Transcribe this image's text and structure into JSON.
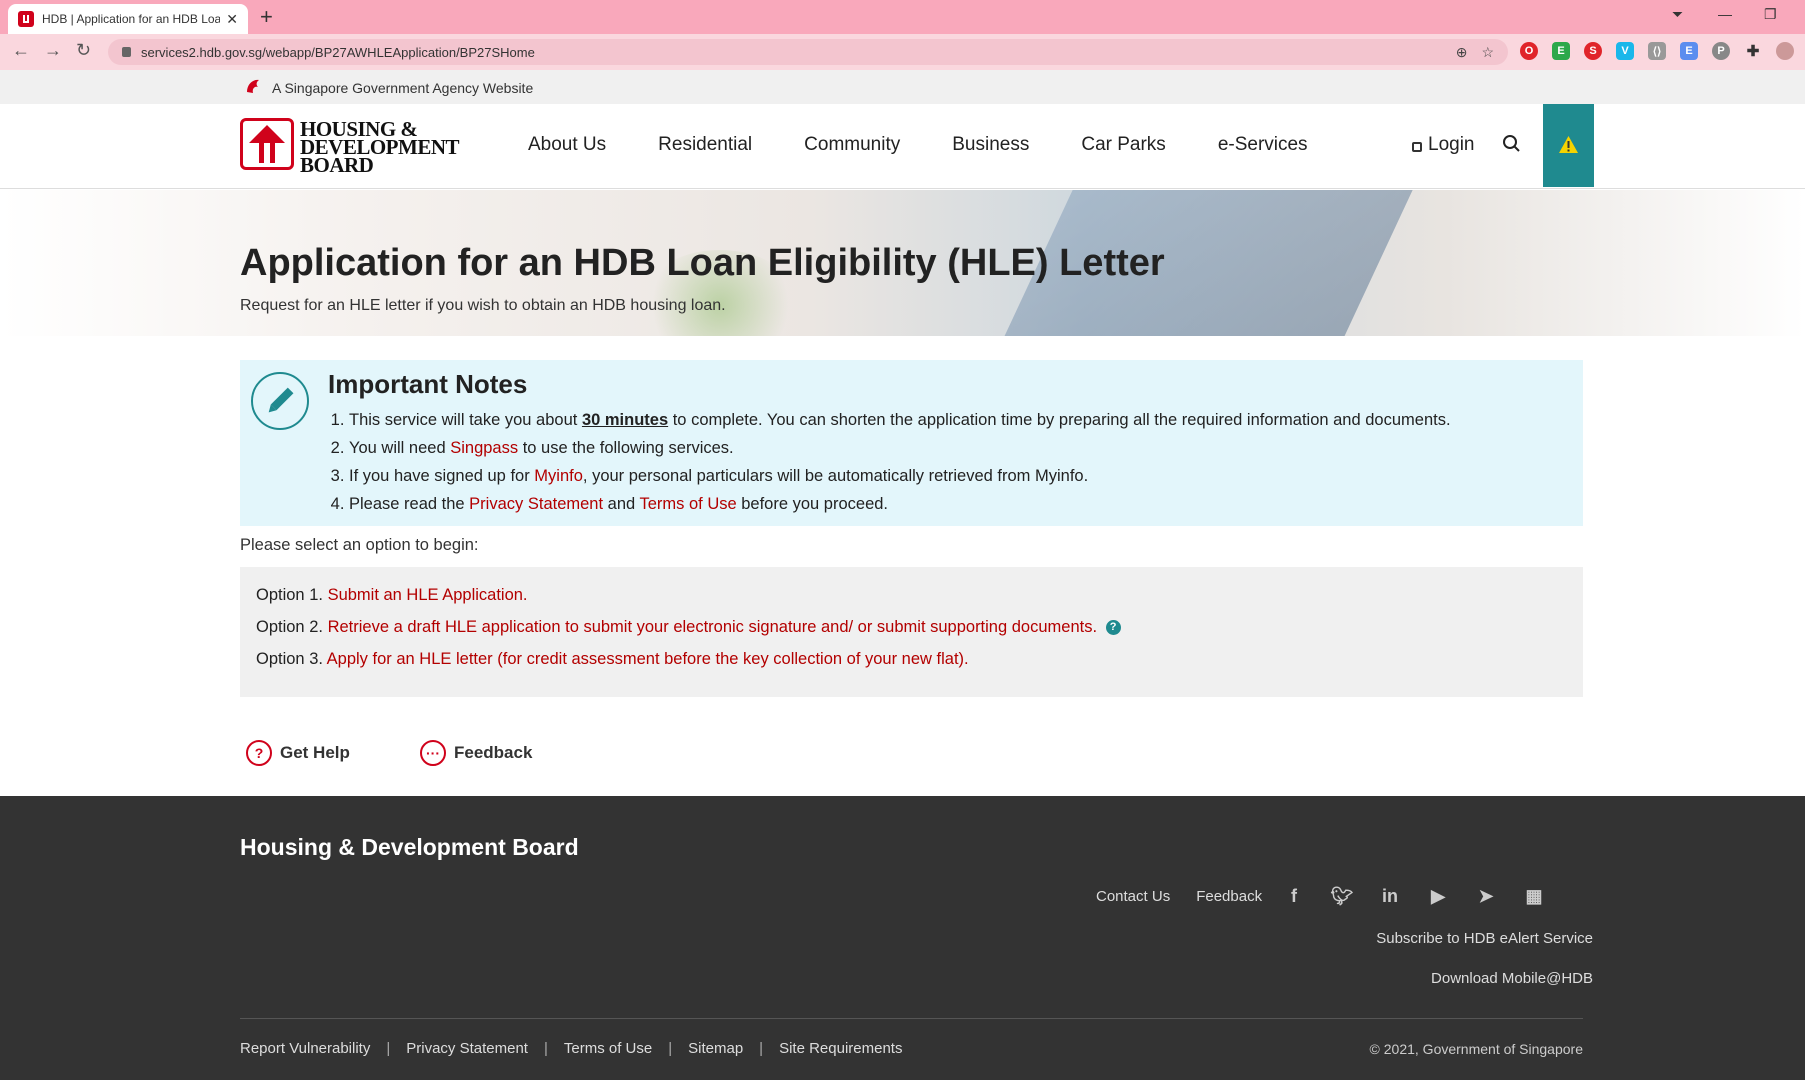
{
  "browser": {
    "tab_title": "HDB | Application for an HDB Loa",
    "url": "services2.hdb.gov.sg/webapp/BP27AWHLEApplication/BP27SHome"
  },
  "masthead": {
    "text": "A Singapore Government Agency Website"
  },
  "logo": {
    "line1": "HOUSING &",
    "line2": "DEVELOPMENT",
    "line3": "BOARD"
  },
  "nav": {
    "items": [
      "About Us",
      "Residential",
      "Community",
      "Business",
      "Car Parks",
      "e-Services"
    ],
    "login": "Login"
  },
  "hero": {
    "title": "Application for an HDB Loan Eligibility (HLE) Letter",
    "subtitle": "Request for an HLE letter if you wish to obtain an HDB housing loan."
  },
  "notes": {
    "heading": "Important Notes",
    "n1_pre": "This service will take you about ",
    "n1_link": "30 minutes",
    "n1_post": " to complete. You can shorten the application time by preparing all the required information and documents.",
    "n2_pre": "You will need ",
    "n2_link": "Singpass",
    "n2_post": " to use the following services.",
    "n3_pre": "If you have signed up for ",
    "n3_link": "Myinfo",
    "n3_post": ", your personal particulars will be automatically retrieved from Myinfo.",
    "n4_pre": "Please read the ",
    "n4_link1": "Privacy Statement",
    "n4_mid": " and ",
    "n4_link2": "Terms of Use",
    "n4_post": " before you proceed."
  },
  "prompt": "Please select an option to begin:",
  "options": [
    {
      "label": "Option 1.",
      "link": "Submit an HLE Application."
    },
    {
      "label": "Option 2.",
      "link": "Retrieve a draft HLE application to submit your electronic signature and/ or submit supporting documents."
    },
    {
      "label": "Option 3.",
      "link": "Apply for an HLE letter (for credit assessment before the key collection of your new flat)."
    }
  ],
  "actions": {
    "get_help": "Get Help",
    "feedback": "Feedback"
  },
  "footer": {
    "org": "Housing & Development Board",
    "contact": "Contact Us",
    "feedback": "Feedback",
    "subscribe": "Subscribe to HDB eAlert Service",
    "download": "Download Mobile@HDB",
    "bottom_links": [
      "Report Vulnerability",
      "Privacy Statement",
      "Terms of Use",
      "Sitemap",
      "Site Requirements"
    ],
    "copyright": "© 2021, Government of Singapore"
  },
  "colors": {
    "accent_red": "#d0021b",
    "teal": "#1f8a8f",
    "notes_bg": "#e3f6fb",
    "footer_bg": "#333333"
  }
}
